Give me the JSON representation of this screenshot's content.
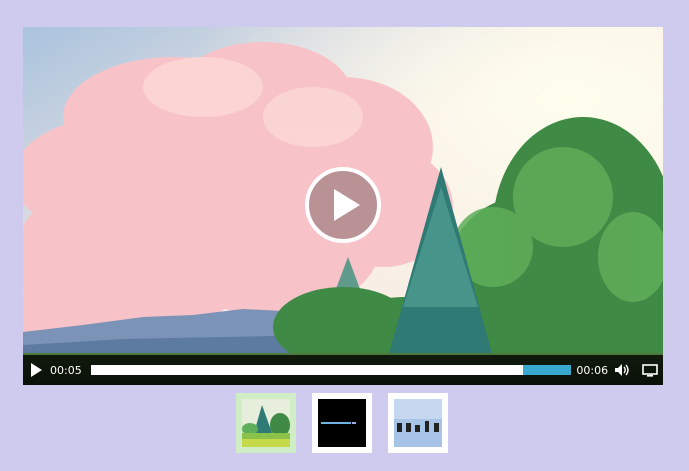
{
  "player": {
    "current_time": "00:05",
    "duration": "00:06",
    "progress_fraction": 0.9,
    "accent_color": "#37a8d0"
  },
  "controls": {
    "play_icon": "play-icon",
    "volume_icon": "volume-icon",
    "fullscreen_icon": "fullscreen-icon"
  },
  "playlist": {
    "active_index": 0,
    "items": [
      {
        "icon": "nature-scene-thumbnail"
      },
      {
        "icon": "dark-title-thumbnail"
      },
      {
        "icon": "sky-scene-thumbnail"
      }
    ]
  }
}
